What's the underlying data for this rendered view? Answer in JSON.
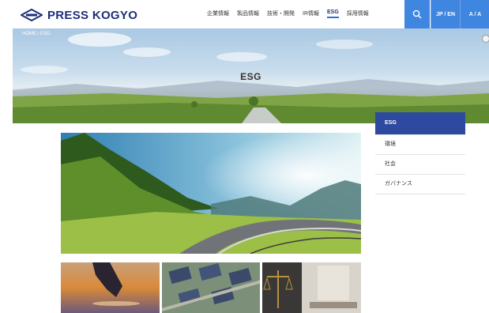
{
  "header": {
    "logo_text": "PRESS KOGYO",
    "nav": [
      {
        "label": "企業情報",
        "active": false
      },
      {
        "label": "製品情報",
        "active": false
      },
      {
        "label": "技術・開発",
        "active": false
      },
      {
        "label": "IR情報",
        "active": false
      },
      {
        "label": "ESG",
        "active": true
      },
      {
        "label": "採用情報",
        "active": false
      }
    ],
    "lang_label": "JP / EN",
    "fontsize_label": "A / A"
  },
  "hero": {
    "breadcrumb": "HOME / ESG",
    "title": "ESG"
  },
  "sidebar": {
    "items": [
      {
        "label": "ESG",
        "active": true
      },
      {
        "label": "環境",
        "active": false
      },
      {
        "label": "社会",
        "active": false
      },
      {
        "label": "ガバナンス",
        "active": false
      }
    ]
  },
  "colors": {
    "brand_navy": "#1d2f7a",
    "header_button_blue": "#3f86e0",
    "sidebar_active": "#2d4aa0"
  },
  "icons": [
    "logo-mark-icon",
    "search-icon"
  ]
}
